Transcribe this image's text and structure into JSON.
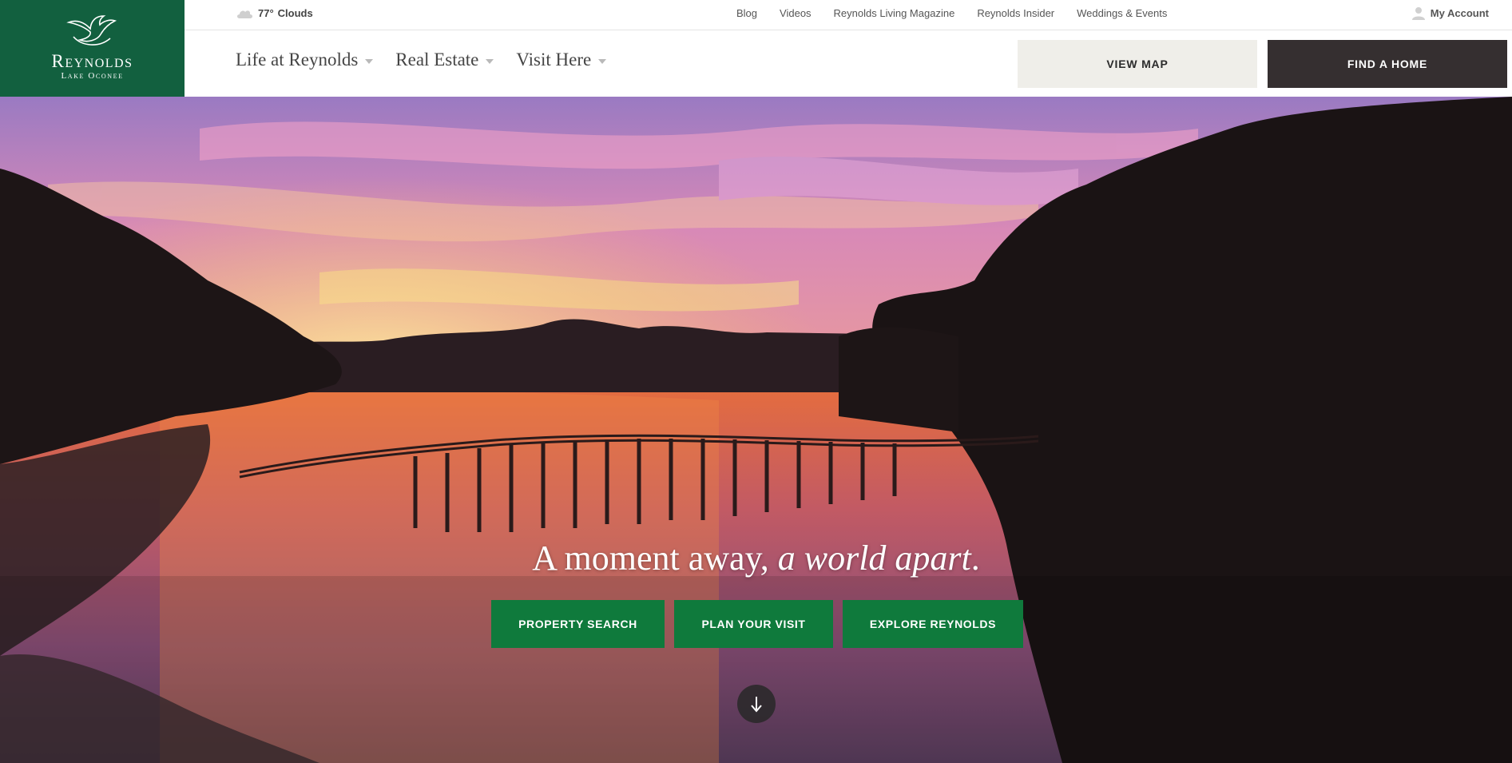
{
  "logo": {
    "brand": "Reynolds",
    "subtitle": "Lake Oconee",
    "icon": "bird-logo-icon"
  },
  "utility": {
    "weather": {
      "icon": "cloud-icon",
      "temp": "77°",
      "condition": "Clouds"
    },
    "links": [
      "Blog",
      "Videos",
      "Reynolds Living Magazine",
      "Reynolds Insider",
      "Weddings & Events"
    ],
    "account": {
      "icon": "user-icon",
      "label": "My Account"
    }
  },
  "nav": {
    "items": [
      {
        "label": "Life at Reynolds",
        "icon": "caret-down-icon"
      },
      {
        "label": "Real Estate",
        "icon": "caret-down-icon"
      },
      {
        "label": "Visit Here",
        "icon": "caret-down-icon"
      }
    ],
    "view_map": "VIEW MAP",
    "find_home": "FIND A HOME"
  },
  "hero": {
    "headline_plain": "A moment away,",
    "headline_italic": "a world apart",
    "headline_end": ".",
    "buttons": [
      "PROPERTY SEARCH",
      "PLAN YOUR VISIT",
      "EXPLORE REYNOLDS"
    ],
    "scroll_icon": "arrow-down-icon"
  },
  "colors": {
    "brand_green": "#12603f",
    "cta_green": "#0f7a3c",
    "find_home_bg": "#352f30",
    "view_map_bg": "#efeee9"
  }
}
